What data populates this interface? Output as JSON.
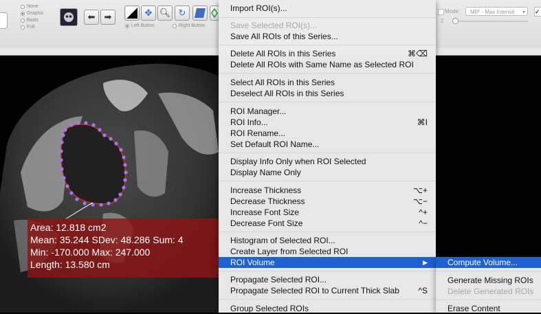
{
  "toolbar": {
    "render_modes": [
      "None",
      "Graphic",
      "Basic",
      "Full"
    ],
    "render_mode_selected": "Graphic",
    "mouse_buttons": [
      "Left Button",
      "Right Button"
    ],
    "mode_label": "Mode:",
    "mode_value": "MIP - Max Intensit",
    "thickness_value": "2"
  },
  "info": {
    "area": "Area: 12.818 cm2",
    "mean": "Mean: 35.244 SDev: 48.286 Sum: 4",
    "minmax": "Min: -170.000 Max: 247.000",
    "length": "Length: 13.580 cm"
  },
  "menu": {
    "import": "Import ROI(s)...",
    "save_selected": "Save Selected ROI(s)...",
    "save_all": "Save All ROIs of this Series...",
    "delete_all": "Delete All ROIs in this Series",
    "delete_all_shortcut": "⌘⌫",
    "delete_same_name": "Delete All ROIs with Same Name as Selected ROI",
    "select_all": "Select All ROIs in this Series",
    "deselect_all": "Deselect All ROIs in this Series",
    "manager": "ROI Manager...",
    "info": "ROI Info...",
    "info_shortcut": "⌘I",
    "rename": "ROI Rename...",
    "default_name": "Set Default ROI Name...",
    "display_info_only": "Display Info Only when ROI Selected",
    "display_name_only": "Display Name Only",
    "increase_thickness": "Increase Thickness",
    "increase_thickness_shortcut": "⌥+",
    "decrease_thickness": "Decrease Thickness",
    "decrease_thickness_shortcut": "⌥−",
    "increase_font": "Increase Font Size",
    "increase_font_shortcut": "^+",
    "decrease_font": "Decrease Font Size",
    "decrease_font_shortcut": "^−",
    "histogram": "Histogram of Selected ROI...",
    "create_layer": "Create Layer from Selected ROI",
    "roi_volume": "ROI Volume",
    "roi_volume_arrow": "▶",
    "propagate": "Propagate Selected ROI...",
    "propagate_thick": "Propagate Selected ROI to Current Thick Slab",
    "propagate_thick_shortcut": "^S",
    "group": "Group Selected ROIs"
  },
  "submenu": {
    "compute_volume": "Compute Volume...",
    "generate_missing": "Generate Missing ROIs",
    "delete_generated": "Delete Generated ROIs",
    "erase_content": "Erase Content"
  },
  "colors": {
    "menu_highlight": "#1e62d0",
    "roi_point": "#9a7cf0",
    "roi_line": "#d22a2a",
    "info_background": "#8c1414"
  }
}
